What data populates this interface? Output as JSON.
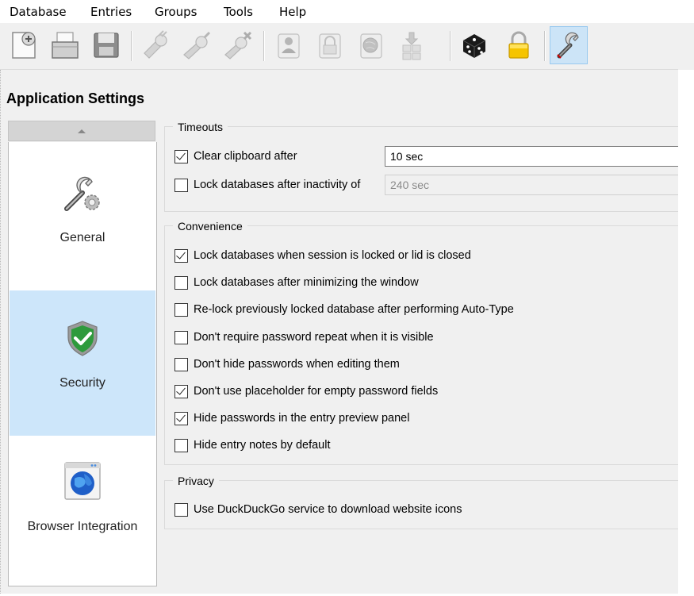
{
  "menubar": {
    "items": [
      "Database",
      "Entries",
      "Groups",
      "Tools",
      "Help"
    ]
  },
  "toolbar": {
    "buttons": [
      {
        "name": "new-database-icon"
      },
      {
        "name": "open-database-icon"
      },
      {
        "name": "save-database-icon"
      },
      {
        "name": "add-entry-icon"
      },
      {
        "name": "edit-entry-icon"
      },
      {
        "name": "delete-entry-icon"
      },
      {
        "name": "copy-username-icon"
      },
      {
        "name": "copy-password-icon"
      },
      {
        "name": "open-url-icon"
      },
      {
        "name": "auto-type-icon"
      },
      {
        "name": "password-generator-icon"
      },
      {
        "name": "lock-databases-icon"
      },
      {
        "name": "settings-icon"
      }
    ]
  },
  "page": {
    "title": "Application Settings"
  },
  "categories": [
    {
      "label": "General",
      "icon": "wrench-gear-icon",
      "selected": false
    },
    {
      "label": "Security",
      "icon": "shield-check-icon",
      "selected": true
    },
    {
      "label": "Browser Integration",
      "icon": "globe-window-icon",
      "selected": false
    }
  ],
  "timeouts": {
    "title": "Timeouts",
    "clear_clipboard": {
      "label": "Clear clipboard after",
      "checked": true,
      "value": "10 sec"
    },
    "lock_inactivity": {
      "label": "Lock databases after inactivity of",
      "checked": false,
      "value": "240 sec"
    }
  },
  "convenience": {
    "title": "Convenience",
    "options": [
      {
        "label": "Lock databases when session is locked or lid is closed",
        "checked": true
      },
      {
        "label": "Lock databases after minimizing the window",
        "checked": false
      },
      {
        "label": "Re-lock previously locked database after performing Auto-Type",
        "checked": false
      },
      {
        "label": "Don't require password repeat when it is visible",
        "checked": false
      },
      {
        "label": "Don't hide passwords when editing them",
        "checked": false
      },
      {
        "label": "Don't use placeholder for empty password fields",
        "checked": true
      },
      {
        "label": "Hide passwords in the entry preview panel",
        "checked": true
      },
      {
        "label": "Hide entry notes by default",
        "checked": false
      }
    ]
  },
  "privacy": {
    "title": "Privacy",
    "options": [
      {
        "label": "Use DuckDuckGo service to download website icons",
        "checked": false
      }
    ]
  },
  "colors": {
    "selected_bg": "#cde6fa",
    "window_bg": "#f0f0f0",
    "shield_green": "#2e9a3c"
  }
}
